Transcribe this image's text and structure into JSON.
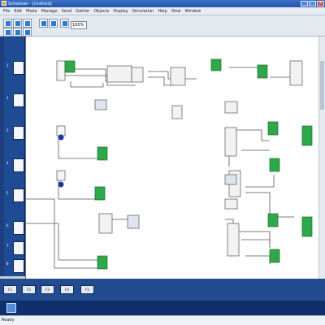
{
  "window": {
    "title": "Scheduler - [Untitled]"
  },
  "menu": [
    "File",
    "Edit",
    "Mode",
    "Manage",
    "Send",
    "Gather",
    "Objects",
    "Display",
    "Simulation",
    "Help",
    "View",
    "Window"
  ],
  "toolbar": {
    "zoom_value": "100%"
  },
  "palette": {
    "items": [
      {
        "num": "1",
        "icon": "trend-block-icon"
      },
      {
        "num": "2",
        "icon": "blue-sensor-icon"
      },
      {
        "num": "3",
        "icon": "signal-icon"
      },
      {
        "num": "4",
        "icon": "step-icon"
      },
      {
        "num": "5",
        "icon": "io-block-icon"
      },
      {
        "num": "6",
        "icon": "blank-block-icon"
      },
      {
        "num": "7",
        "icon": "blank-block-icon"
      },
      {
        "num": "8",
        "icon": "blank-block-icon"
      }
    ]
  },
  "bottom_tabs": [
    "F1",
    "F2",
    "F3",
    "F4",
    "F5"
  ],
  "status": {
    "text": "Ready"
  },
  "colors": {
    "block_green": "#2ea84a",
    "wire": "#5a5a5a",
    "palette_bg": "#1f4a94"
  }
}
